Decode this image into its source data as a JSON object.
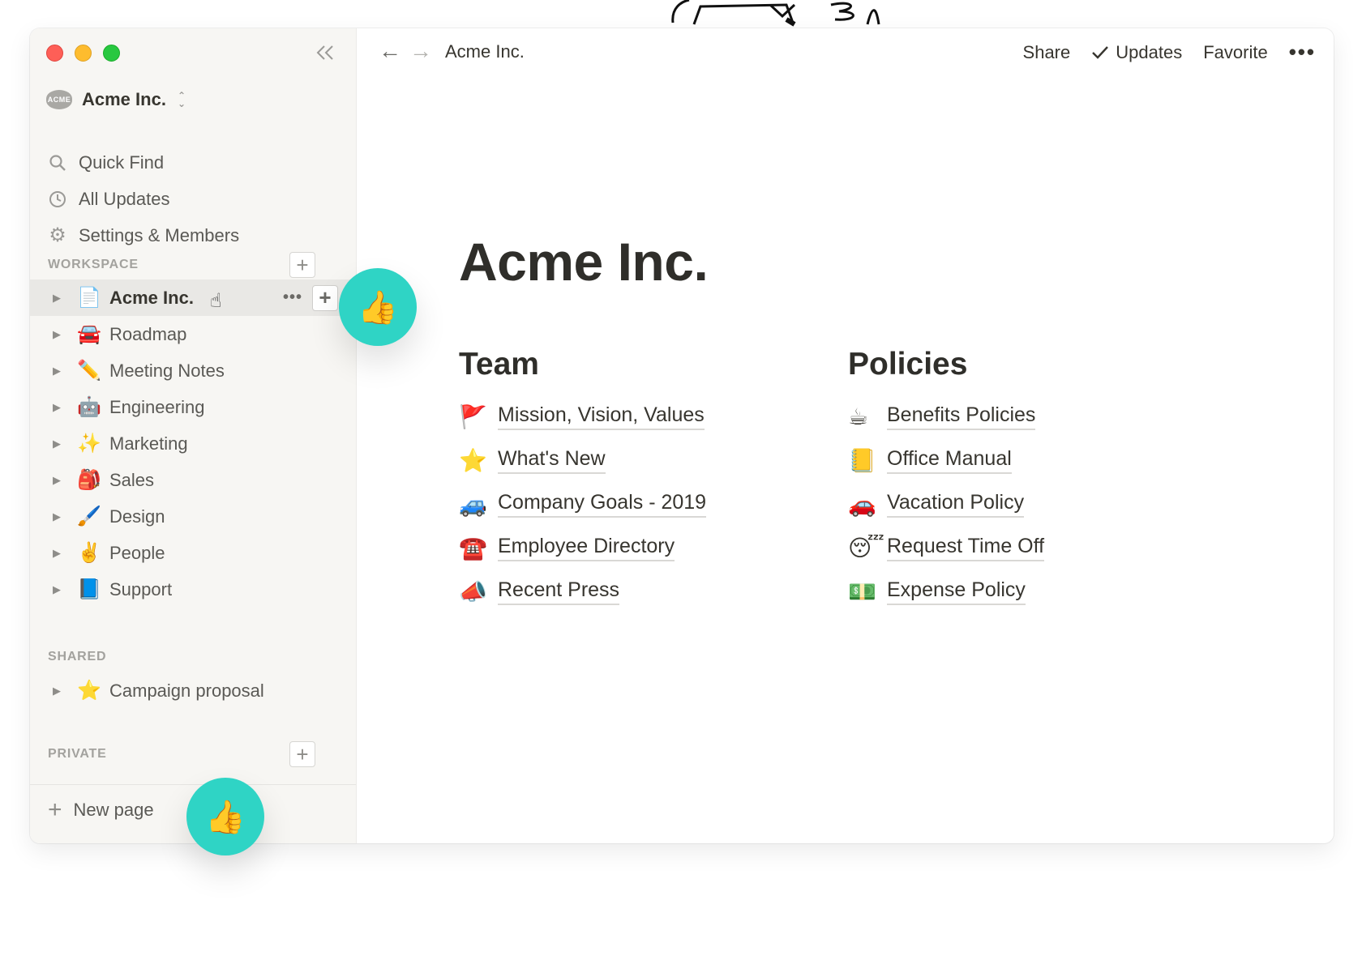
{
  "window": {
    "workspace_name": "Acme Inc.",
    "workspace_logo_text": "ACME"
  },
  "sidebar": {
    "nav": [
      {
        "label": "Quick Find",
        "icon": "search-icon"
      },
      {
        "label": "All Updates",
        "icon": "clock-icon"
      },
      {
        "label": "Settings & Members",
        "icon": "gear-icon"
      }
    ],
    "workspace_label": "WORKSPACE",
    "workspace_pages": [
      {
        "label": "Acme Inc.",
        "emoji": "📄",
        "active": true
      },
      {
        "label": "Roadmap",
        "emoji": "🚘"
      },
      {
        "label": "Meeting Notes",
        "emoji": "✏️"
      },
      {
        "label": "Engineering",
        "emoji": "🤖"
      },
      {
        "label": "Marketing",
        "emoji": "✨"
      },
      {
        "label": "Sales",
        "emoji": "🎒"
      },
      {
        "label": "Design",
        "emoji": "🖌️"
      },
      {
        "label": "People",
        "emoji": "✌️"
      },
      {
        "label": "Support",
        "emoji": "📘"
      }
    ],
    "shared_label": "SHARED",
    "shared_pages": [
      {
        "label": "Campaign proposal",
        "emoji": "⭐"
      }
    ],
    "private_label": "PRIVATE",
    "new_page_label": "New page"
  },
  "topbar": {
    "breadcrumb": "Acme Inc.",
    "share": "Share",
    "updates": "Updates",
    "favorite": "Favorite",
    "more": "•••"
  },
  "content": {
    "title": "Acme Inc.",
    "columns": [
      {
        "heading": "Team",
        "links": [
          {
            "emoji": "🚩",
            "label": "Mission, Vision, Values"
          },
          {
            "emoji": "⭐",
            "label": "What's New"
          },
          {
            "emoji": "🚙",
            "label": "Company Goals - 2019"
          },
          {
            "emoji": "☎️",
            "label": "Employee Directory"
          },
          {
            "emoji": "📣",
            "label": "Recent Press"
          }
        ]
      },
      {
        "heading": "Policies",
        "links": [
          {
            "emoji": "☕",
            "label": "Benefits Policies"
          },
          {
            "emoji": "📒",
            "label": "Office Manual"
          },
          {
            "emoji": "🚗",
            "label": "Vacation Policy"
          },
          {
            "emoji": "😴",
            "label": "Request Time Off"
          },
          {
            "emoji": "💵",
            "label": "Expense Policy"
          }
        ]
      }
    ]
  },
  "badges": {
    "emoji": "👍",
    "color": "#2fd4c5"
  }
}
